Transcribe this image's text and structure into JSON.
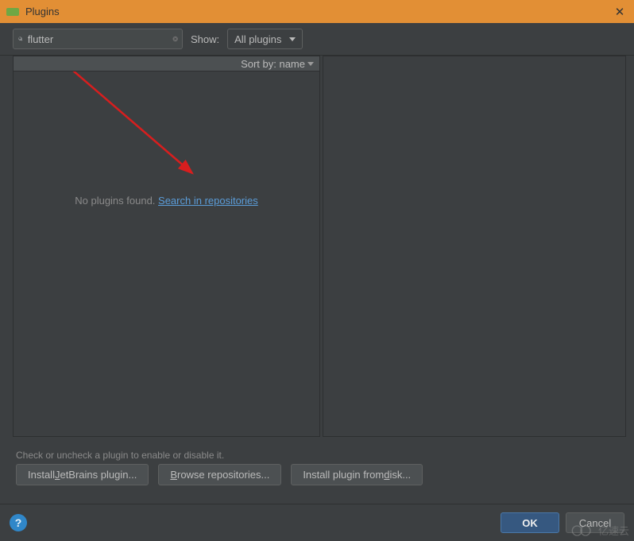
{
  "window": {
    "title": "Plugins"
  },
  "toolbar": {
    "search_value": "flutter",
    "show_label": "Show:",
    "show_selected": "All plugins"
  },
  "list": {
    "sort_label": "Sort by: name",
    "empty_prefix": "No plugins found. ",
    "empty_link": "Search in repositories"
  },
  "hint": "Check or uncheck a plugin to enable or disable it.",
  "buttons": {
    "install_jetbrains": "Install JetBrains plugin...",
    "browse_repos": "Browse repositories...",
    "install_disk": "Install plugin from disk..."
  },
  "footer": {
    "ok": "OK",
    "cancel": "Cancel"
  },
  "watermark": "亿速云",
  "accent_letters": {
    "j": "J",
    "b": "B",
    "d": "d"
  }
}
